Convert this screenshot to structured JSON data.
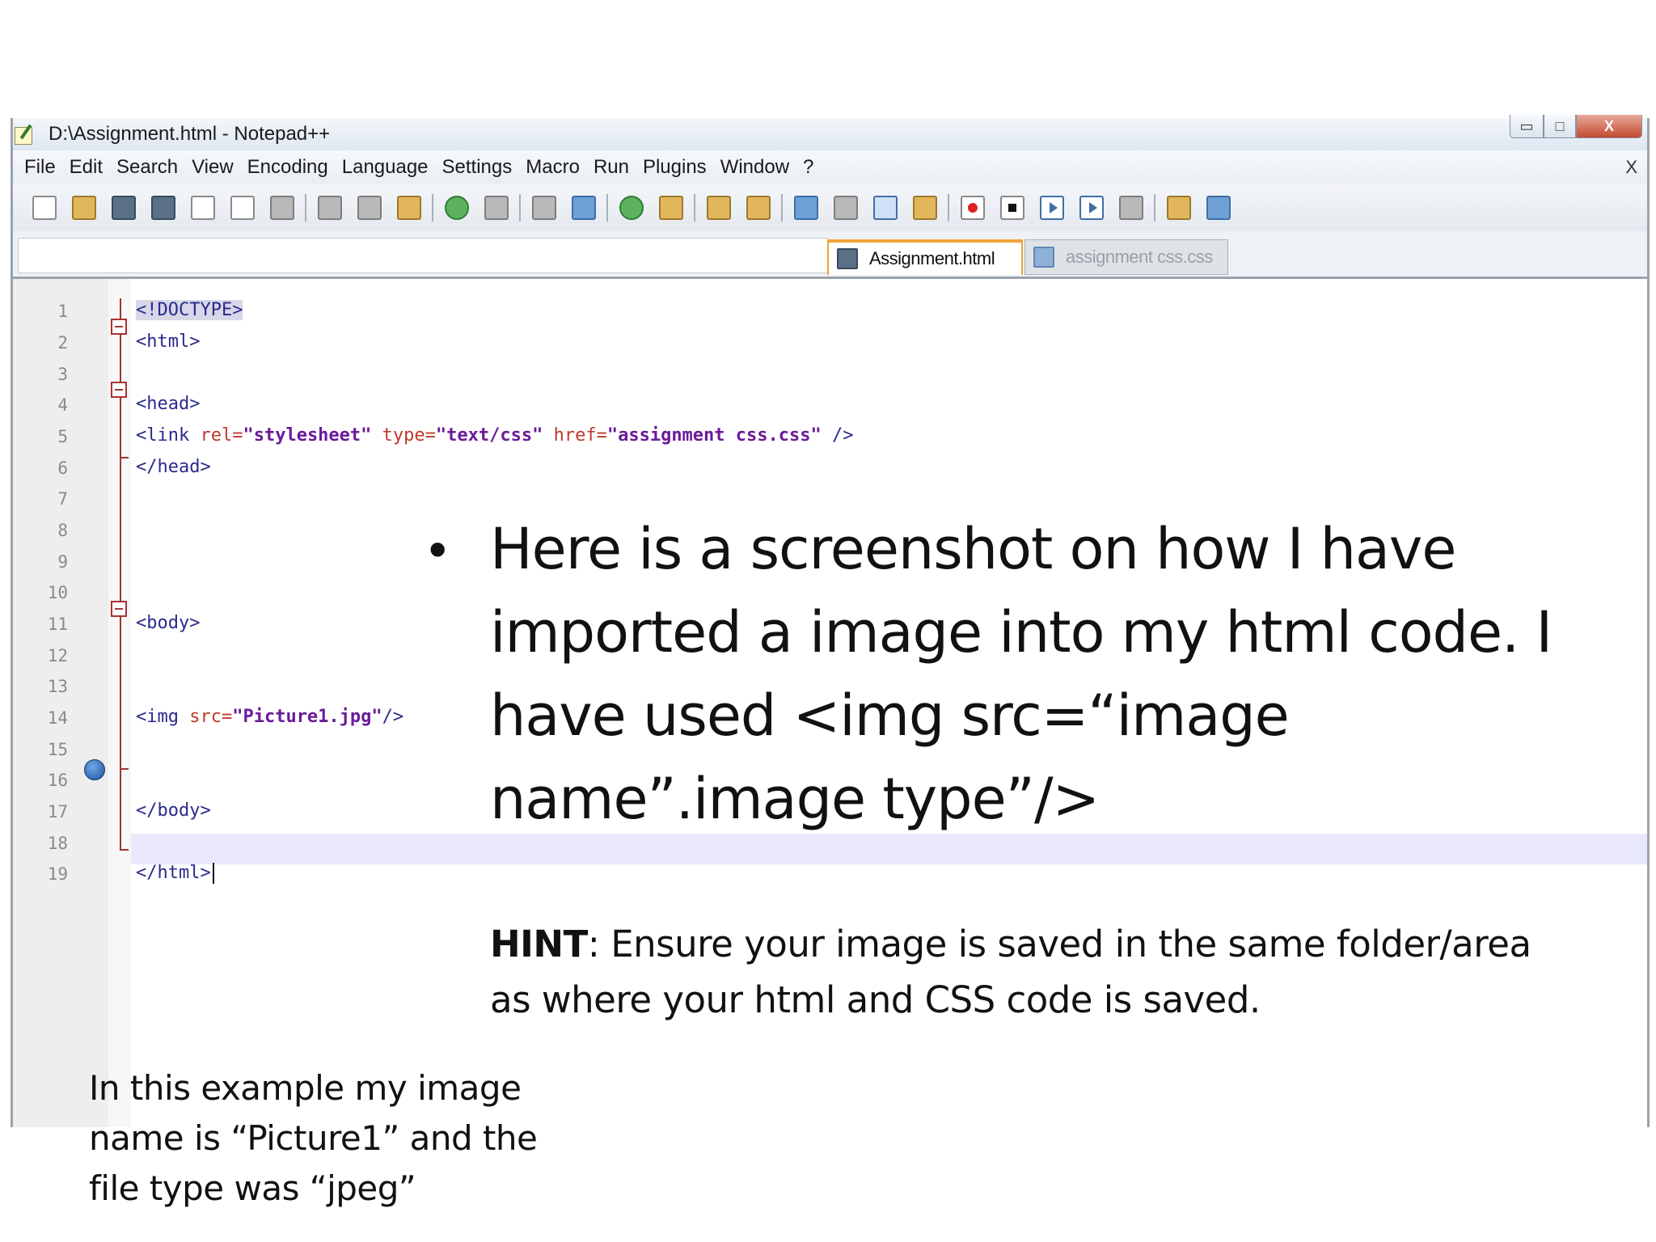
{
  "window": {
    "title": "D:\\Assignment.html - Notepad++",
    "controls": {
      "minimize": "▭",
      "maximize": "□",
      "close": "X"
    }
  },
  "menu": {
    "items": [
      "File",
      "Edit",
      "Search",
      "View",
      "Encoding",
      "Language",
      "Settings",
      "Macro",
      "Run",
      "Plugins",
      "Window",
      "?"
    ],
    "close": "X"
  },
  "tabs": [
    {
      "label": "Assignment.html",
      "active": true
    },
    {
      "label": "assignment css.css",
      "active": false
    }
  ],
  "editor": {
    "line_numbers": [
      "1",
      "2",
      "3",
      "4",
      "5",
      "6",
      "7",
      "8",
      "9",
      "10",
      "11",
      "12",
      "13",
      "14",
      "15",
      "16",
      "17",
      "18",
      "19"
    ],
    "current_line": "19",
    "bookmark_line": "15",
    "code": {
      "l1": "<!DOCTYPE>",
      "l2": "<html>",
      "l4": "<head>",
      "l5_open": "<link ",
      "l5_rel_attr": "rel=",
      "l5_rel_val": "\"stylesheet\"",
      "l5_type_attr": " type=",
      "l5_type_val": "\"text/css\"",
      "l5_href_attr": " href=",
      "l5_href_val": "\"assignment css.css\"",
      "l5_close": " />",
      "l6": "</head>",
      "l11": "<body>",
      "l14_open": "<img ",
      "l14_src_attr": "src=",
      "l14_src_val": "\"Picture1.jpg\"",
      "l14_close": "/>",
      "l17": "</body>",
      "l19": "</html>"
    }
  },
  "slide": {
    "bullet": "•",
    "main_text": "Here is a screenshot on how I have imported a image into my html code. I have used <img src=“image name”.image type”/>",
    "hint_label": "HINT",
    "hint_text": ": Ensure your image is saved in the same folder/area as where your html and CSS code is saved.",
    "note": "In this example my image name is “Picture1” and the file type was “jpeg”"
  }
}
